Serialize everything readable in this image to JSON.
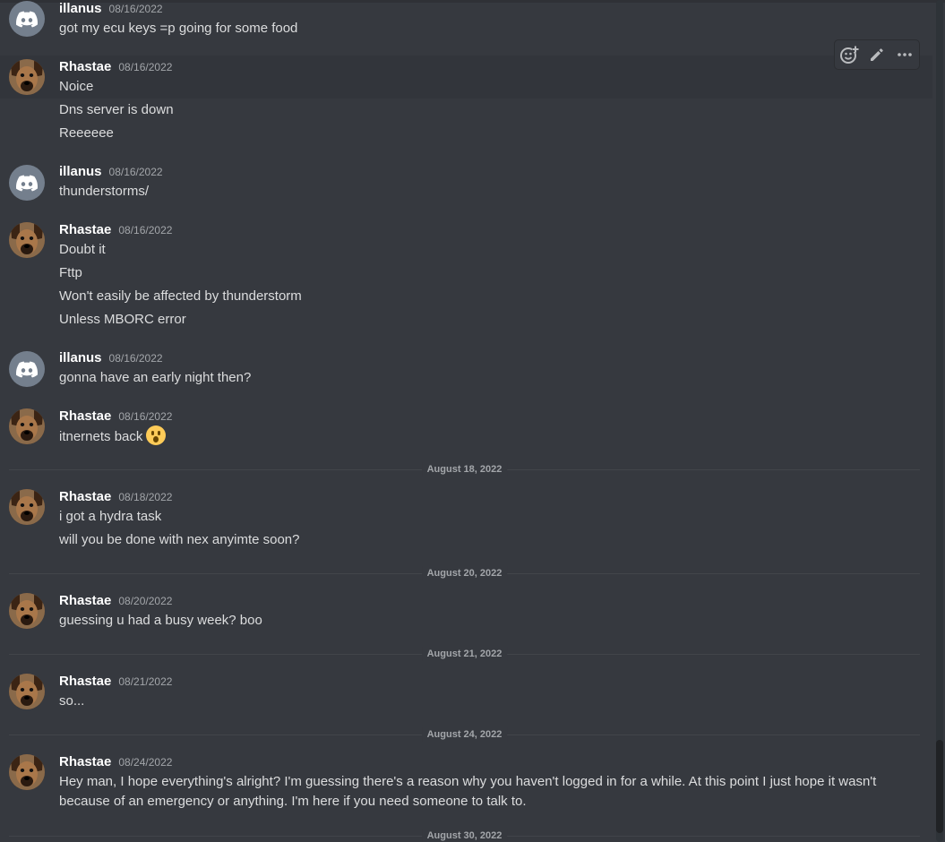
{
  "messages": [
    {
      "user": "illanus",
      "date": "08/16/2022",
      "avatar": "discord-icon",
      "lines": [
        "got my ecu keys =p going for some food"
      ]
    },
    {
      "user": "Rhastae",
      "date": "08/16/2022",
      "avatar": "dog-avatar",
      "lines": [
        "Noice",
        "Dns server is down",
        "Reeeeee"
      ]
    },
    {
      "user": "illanus",
      "date": "08/16/2022",
      "avatar": "discord-icon",
      "lines": [
        "thunderstorms/"
      ]
    },
    {
      "user": "Rhastae",
      "date": "08/16/2022",
      "avatar": "dog-avatar",
      "lines": [
        "Doubt it",
        "Fttp",
        "Won't easily be affected by thunderstorm",
        "Unless MBORC error"
      ]
    },
    {
      "user": "illanus",
      "date": "08/16/2022",
      "avatar": "discord-icon",
      "lines": [
        "gonna have an early night then?"
      ]
    },
    {
      "user": "Rhastae",
      "date": "08/16/2022",
      "avatar": "dog-avatar",
      "lines": [
        "itnernets back"
      ],
      "emoji": "hushed-face-emoji"
    },
    {
      "user": "Rhastae",
      "date": "08/18/2022",
      "avatar": "dog-avatar",
      "lines": [
        "i got a hydra task",
        "will you be done with nex anyimte soon?"
      ]
    },
    {
      "user": "Rhastae",
      "date": "08/20/2022",
      "avatar": "dog-avatar",
      "lines": [
        "guessing u had a busy week? boo"
      ]
    },
    {
      "user": "Rhastae",
      "date": "08/21/2022",
      "avatar": "dog-avatar",
      "lines": [
        "so..."
      ]
    },
    {
      "user": "Rhastae",
      "date": "08/24/2022",
      "avatar": "dog-avatar",
      "lines": [
        "Hey man, I hope everything's alright? I'm guessing there's a reason why you haven't logged in for a while. At this point I just hope it wasn't because of an emergency or anything. I'm here if you need someone to talk to."
      ]
    }
  ],
  "dividers": [
    "August 18, 2022",
    "August 20, 2022",
    "August 21, 2022",
    "August 24, 2022",
    "August 30, 2022"
  ],
  "toolbar": {
    "icons": [
      "add-reaction-icon",
      "edit-icon",
      "more-options-icon"
    ]
  },
  "colors": {
    "background": "#36393f",
    "username": "#ffffff",
    "text": "#dcddde",
    "timestamp": "#a3a6aa",
    "avatar_default": "#747f8d"
  }
}
